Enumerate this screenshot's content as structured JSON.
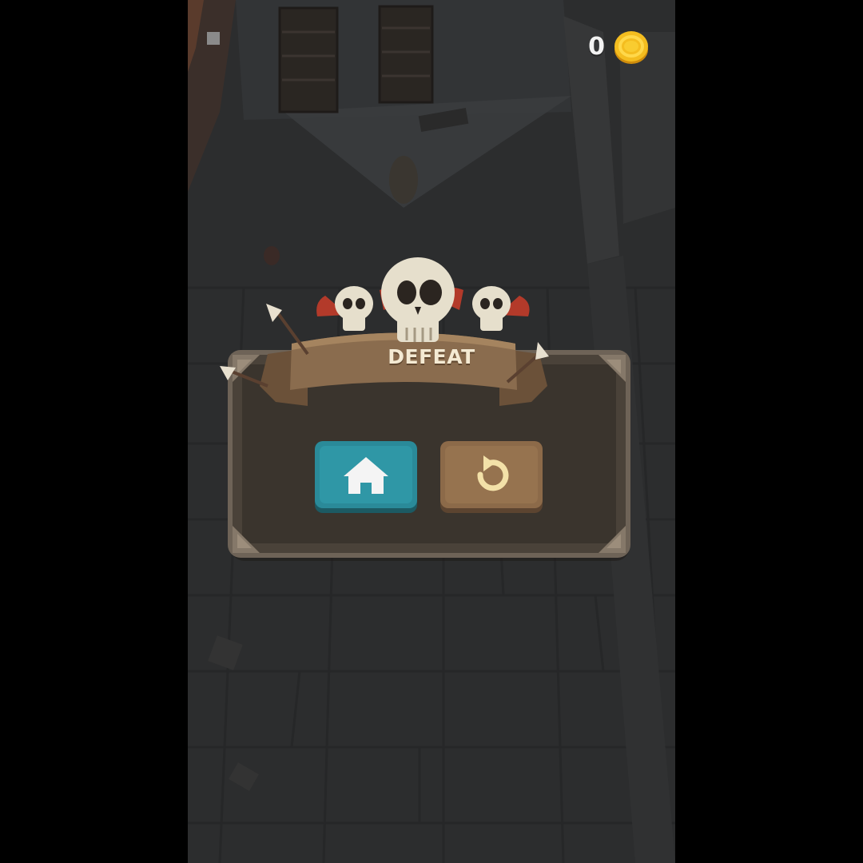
{
  "hud": {
    "coins": "0",
    "coin_icon": "gold-coin-icon"
  },
  "defeat_panel": {
    "title": "DEFEAT",
    "home_icon": "home-icon",
    "retry_icon": "retry-icon"
  },
  "colors": {
    "background": "#2c2d2e",
    "panel": "#3a342d",
    "banner": "#8a6c4e",
    "home_button": "#2a8a99",
    "retry_button": "#8c6a49",
    "coin": "#f4bd1f"
  }
}
